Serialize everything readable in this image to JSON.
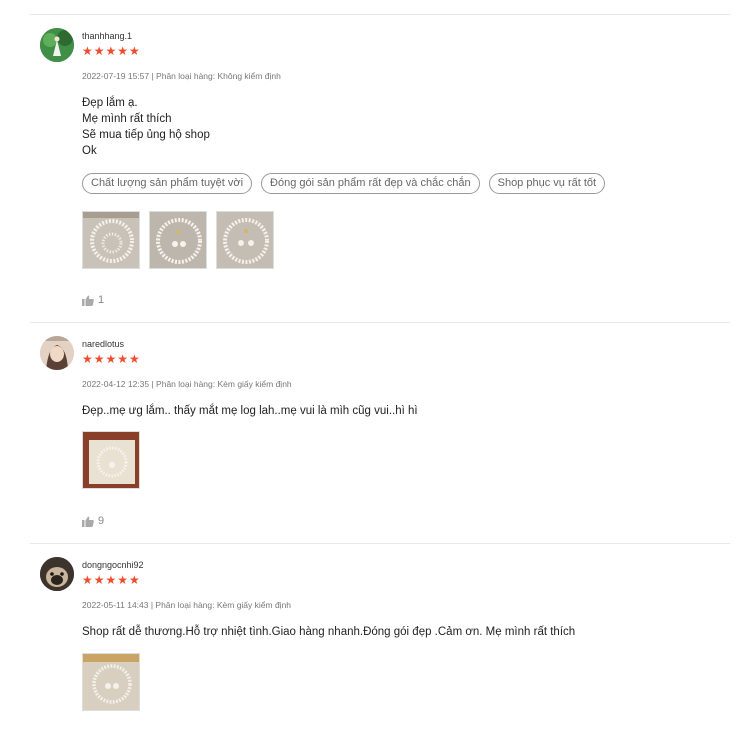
{
  "reviews": [
    {
      "username": "thanhhang.1",
      "stars": "★★★★★",
      "meta": "2022-07-19 15:57 | Phân loại hàng: Không kiểm định",
      "content": [
        "Đẹp lắm ạ.",
        "Mẹ mình rất thích",
        "Sẽ mua tiếp ủng hộ shop",
        "Ok"
      ],
      "tags": [
        "Chất lượng sản phẩm tuyệt vời",
        "Đóng gói sản phẩm rất đẹp và chắc chắn",
        "Shop phục vụ rất tốt"
      ],
      "likes": "1"
    },
    {
      "username": "naredlotus",
      "stars": "★★★★★",
      "meta": "2022-04-12 12:35 | Phân loại hàng: Kèm giấy kiểm định",
      "content": [
        "Đẹp..mẹ ưg lắm.. thấy mắt mẹ log lah..mẹ vui là mìh cũg vui..hì hì"
      ],
      "likes": "9"
    },
    {
      "username": "dongngocnhi92",
      "stars": "★★★★★",
      "meta": "2022-05-11 14:43 | Phân loại hàng: Kèm giấy kiểm định",
      "content": [
        "Shop rất dễ thương.Hỗ trợ nhiệt tình.Giao hàng nhanh.Đóng gói đẹp .Cảm ơn. Mẹ mình rất thích"
      ]
    }
  ],
  "icons": {
    "like": "thumbs-up-icon",
    "star": "star-icon"
  },
  "colors": {
    "star": "#ee4d2d",
    "divider": "#e8e8e8",
    "tag_border": "#999999"
  }
}
